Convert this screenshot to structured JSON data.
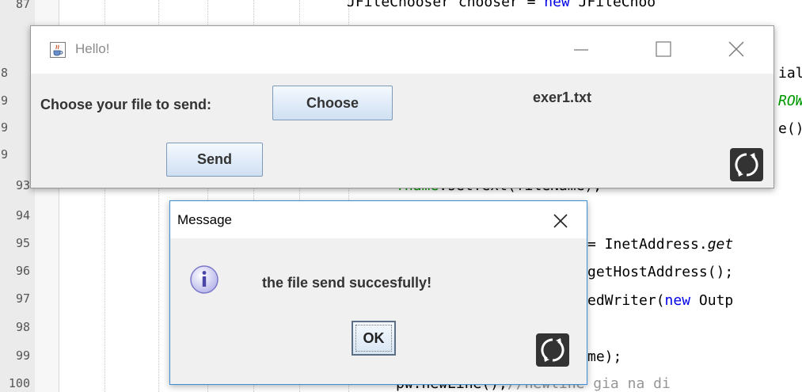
{
  "editor": {
    "line_numbers": [
      "87",
      "8",
      "9",
      "9",
      "9",
      "93",
      "94",
      "95",
      "96",
      "97",
      "98",
      "99",
      "100"
    ],
    "code_lines": [
      {
        "parts": [
          {
            "t": "JFileChooser chooser = ",
            "c": ""
          },
          {
            "t": "new",
            "c": "kw"
          },
          {
            "t": " JFileChoo",
            "c": ""
          }
        ]
      },
      {
        "parts": [
          {
            "t": "ial",
            "c": ""
          }
        ]
      },
      {
        "parts": [
          {
            "t": "ROW",
            "c": "fld it"
          }
        ]
      },
      {
        "parts": [
          {
            "t": "e()",
            "c": ""
          }
        ]
      },
      {
        "parts": [
          {
            "t": "fname",
            "c": "fld"
          },
          {
            "t": ".setText(fileName);",
            "c": ""
          }
        ]
      },
      {
        "parts": [
          {
            "t": "= InetAddress.",
            "c": ""
          },
          {
            "t": "get",
            "c": "it"
          }
        ]
      },
      {
        "parts": [
          {
            "t": "getHostAddress();",
            "c": ""
          }
        ]
      },
      {
        "parts": [
          {
            "t": "edWriter(",
            "c": ""
          },
          {
            "t": "new",
            "c": "kw"
          },
          {
            "t": " Outp",
            "c": ""
          }
        ]
      },
      {
        "parts": [
          {
            "t": "me);",
            "c": ""
          }
        ]
      },
      {
        "parts": [
          {
            "t": "pw.newLine();",
            "c": ""
          },
          {
            "t": "//newline gia na di",
            "c": "cm"
          }
        ]
      }
    ]
  },
  "hello_frame": {
    "title": "Hello!",
    "choose_label": "Choose your file to send:",
    "choose_button": "Choose",
    "file_name": "exer1.txt",
    "send_button": "Send",
    "icons": {
      "app": "java-coffee-icon",
      "minimize": "minimize-icon",
      "maximize": "maximize-icon",
      "close": "close-icon",
      "overlay": "sync-icon"
    }
  },
  "message_dialog": {
    "title": "Message",
    "text": "the file send succesfully!",
    "ok_button": "OK",
    "icons": {
      "info": "info-icon",
      "close": "close-icon",
      "overlay": "sync-icon"
    }
  },
  "colors": {
    "keyword": "#0000e6",
    "field": "#009900",
    "comment": "#969696",
    "dialog_border": "#3c8fd6",
    "button_border": "#7f99b8"
  }
}
